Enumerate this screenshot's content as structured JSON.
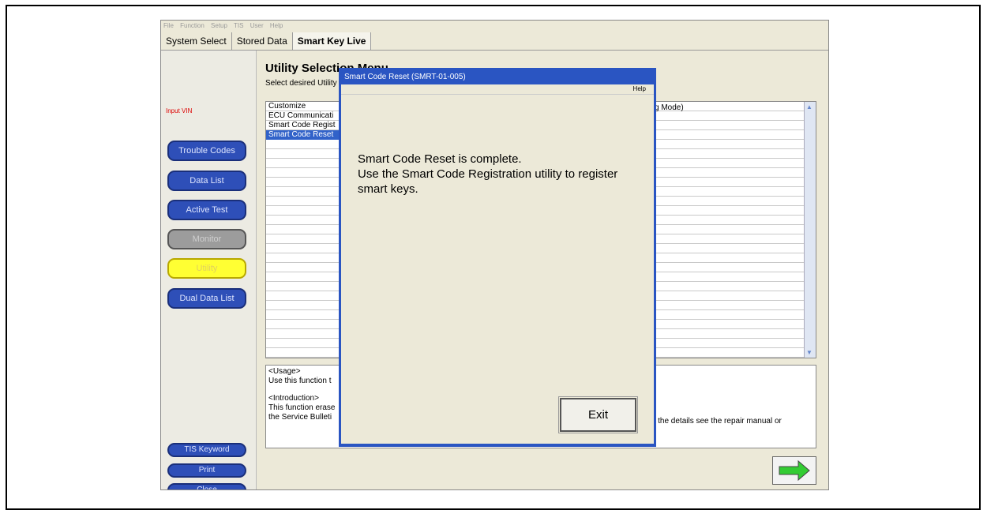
{
  "menubar": {
    "items": [
      "File",
      "Function",
      "Setup",
      "TIS",
      "User",
      "Help"
    ]
  },
  "tabs": [
    {
      "label": "System Select"
    },
    {
      "label": "Stored Data"
    },
    {
      "label": "Smart Key Live"
    }
  ],
  "sidebar": {
    "input_vin": "Input VIN",
    "buttons": {
      "trouble_codes": "Trouble Codes",
      "data_list": "Data List",
      "active_test": "Active Test",
      "monitor": "Monitor",
      "utility": "Utility",
      "dual_data_list": "Dual Data List",
      "tis_keyword": "TIS Keyword",
      "print": "Print",
      "close": "Close"
    }
  },
  "main": {
    "title": "Utility Selection Menu",
    "subtitle": "Select desired Utility",
    "list": {
      "items": [
        "Customize",
        "ECU Communicati",
        "Smart Code Regist",
        "Smart Code Reset"
      ],
      "selected_index": 3,
      "right_text": "g Mode)"
    },
    "description": {
      "usage_heading": "<Usage>",
      "usage_text": "Use this function t",
      "intro_heading": "<Introduction>",
      "intro_text_1": "This function erase",
      "intro_text_2": "the Service Bulleti",
      "right_text": "r the details see the repair manual or"
    }
  },
  "dialog": {
    "title": "Smart Code Reset (SMRT-01-005)",
    "menu_help": "Help",
    "message": "Smart Code Reset is complete.\nUse the Smart Code Registration utility to register\nsmart keys.",
    "exit_label": "Exit"
  },
  "colors": {
    "nav_button": "#2e4fb8",
    "dialog_frame": "#2a55c2",
    "selected_row": "#3162c9",
    "utility_active": "#ffff33",
    "next_arrow": "#33cc33"
  }
}
